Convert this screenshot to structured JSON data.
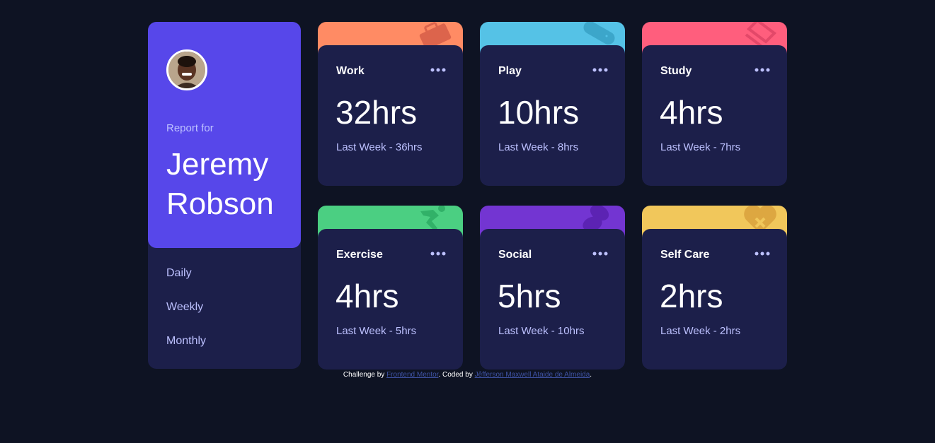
{
  "profile": {
    "report_for": "Report for",
    "name": "Jeremy Robson",
    "periods": [
      "Daily",
      "Weekly",
      "Monthly"
    ]
  },
  "cards": [
    {
      "title": "Work",
      "current": "32hrs",
      "previous": "Last Week - 36hrs",
      "color": "#ff8b64",
      "icon": "briefcase-icon"
    },
    {
      "title": "Play",
      "current": "10hrs",
      "previous": "Last Week - 8hrs",
      "color": "#55c2e6",
      "icon": "gamepad-icon"
    },
    {
      "title": "Study",
      "current": "4hrs",
      "previous": "Last Week - 7hrs",
      "color": "#ff5e7d",
      "icon": "books-icon"
    },
    {
      "title": "Exercise",
      "current": "4hrs",
      "previous": "Last Week - 5hrs",
      "color": "#4bcf82",
      "icon": "running-icon"
    },
    {
      "title": "Social",
      "current": "5hrs",
      "previous": "Last Week - 10hrs",
      "color": "#7335d2",
      "icon": "social-icon"
    },
    {
      "title": "Self Care",
      "current": "2hrs",
      "previous": "Last Week - 2hrs",
      "color": "#f1c75b",
      "icon": "heart-icon"
    }
  ],
  "footer": {
    "prefix": "Challenge by ",
    "challenge_link": "Frontend Mentor",
    "middle": ". Coded by ",
    "author_link": "Jêfferson Maxwell Ataide de Almeida",
    "suffix": "."
  }
}
